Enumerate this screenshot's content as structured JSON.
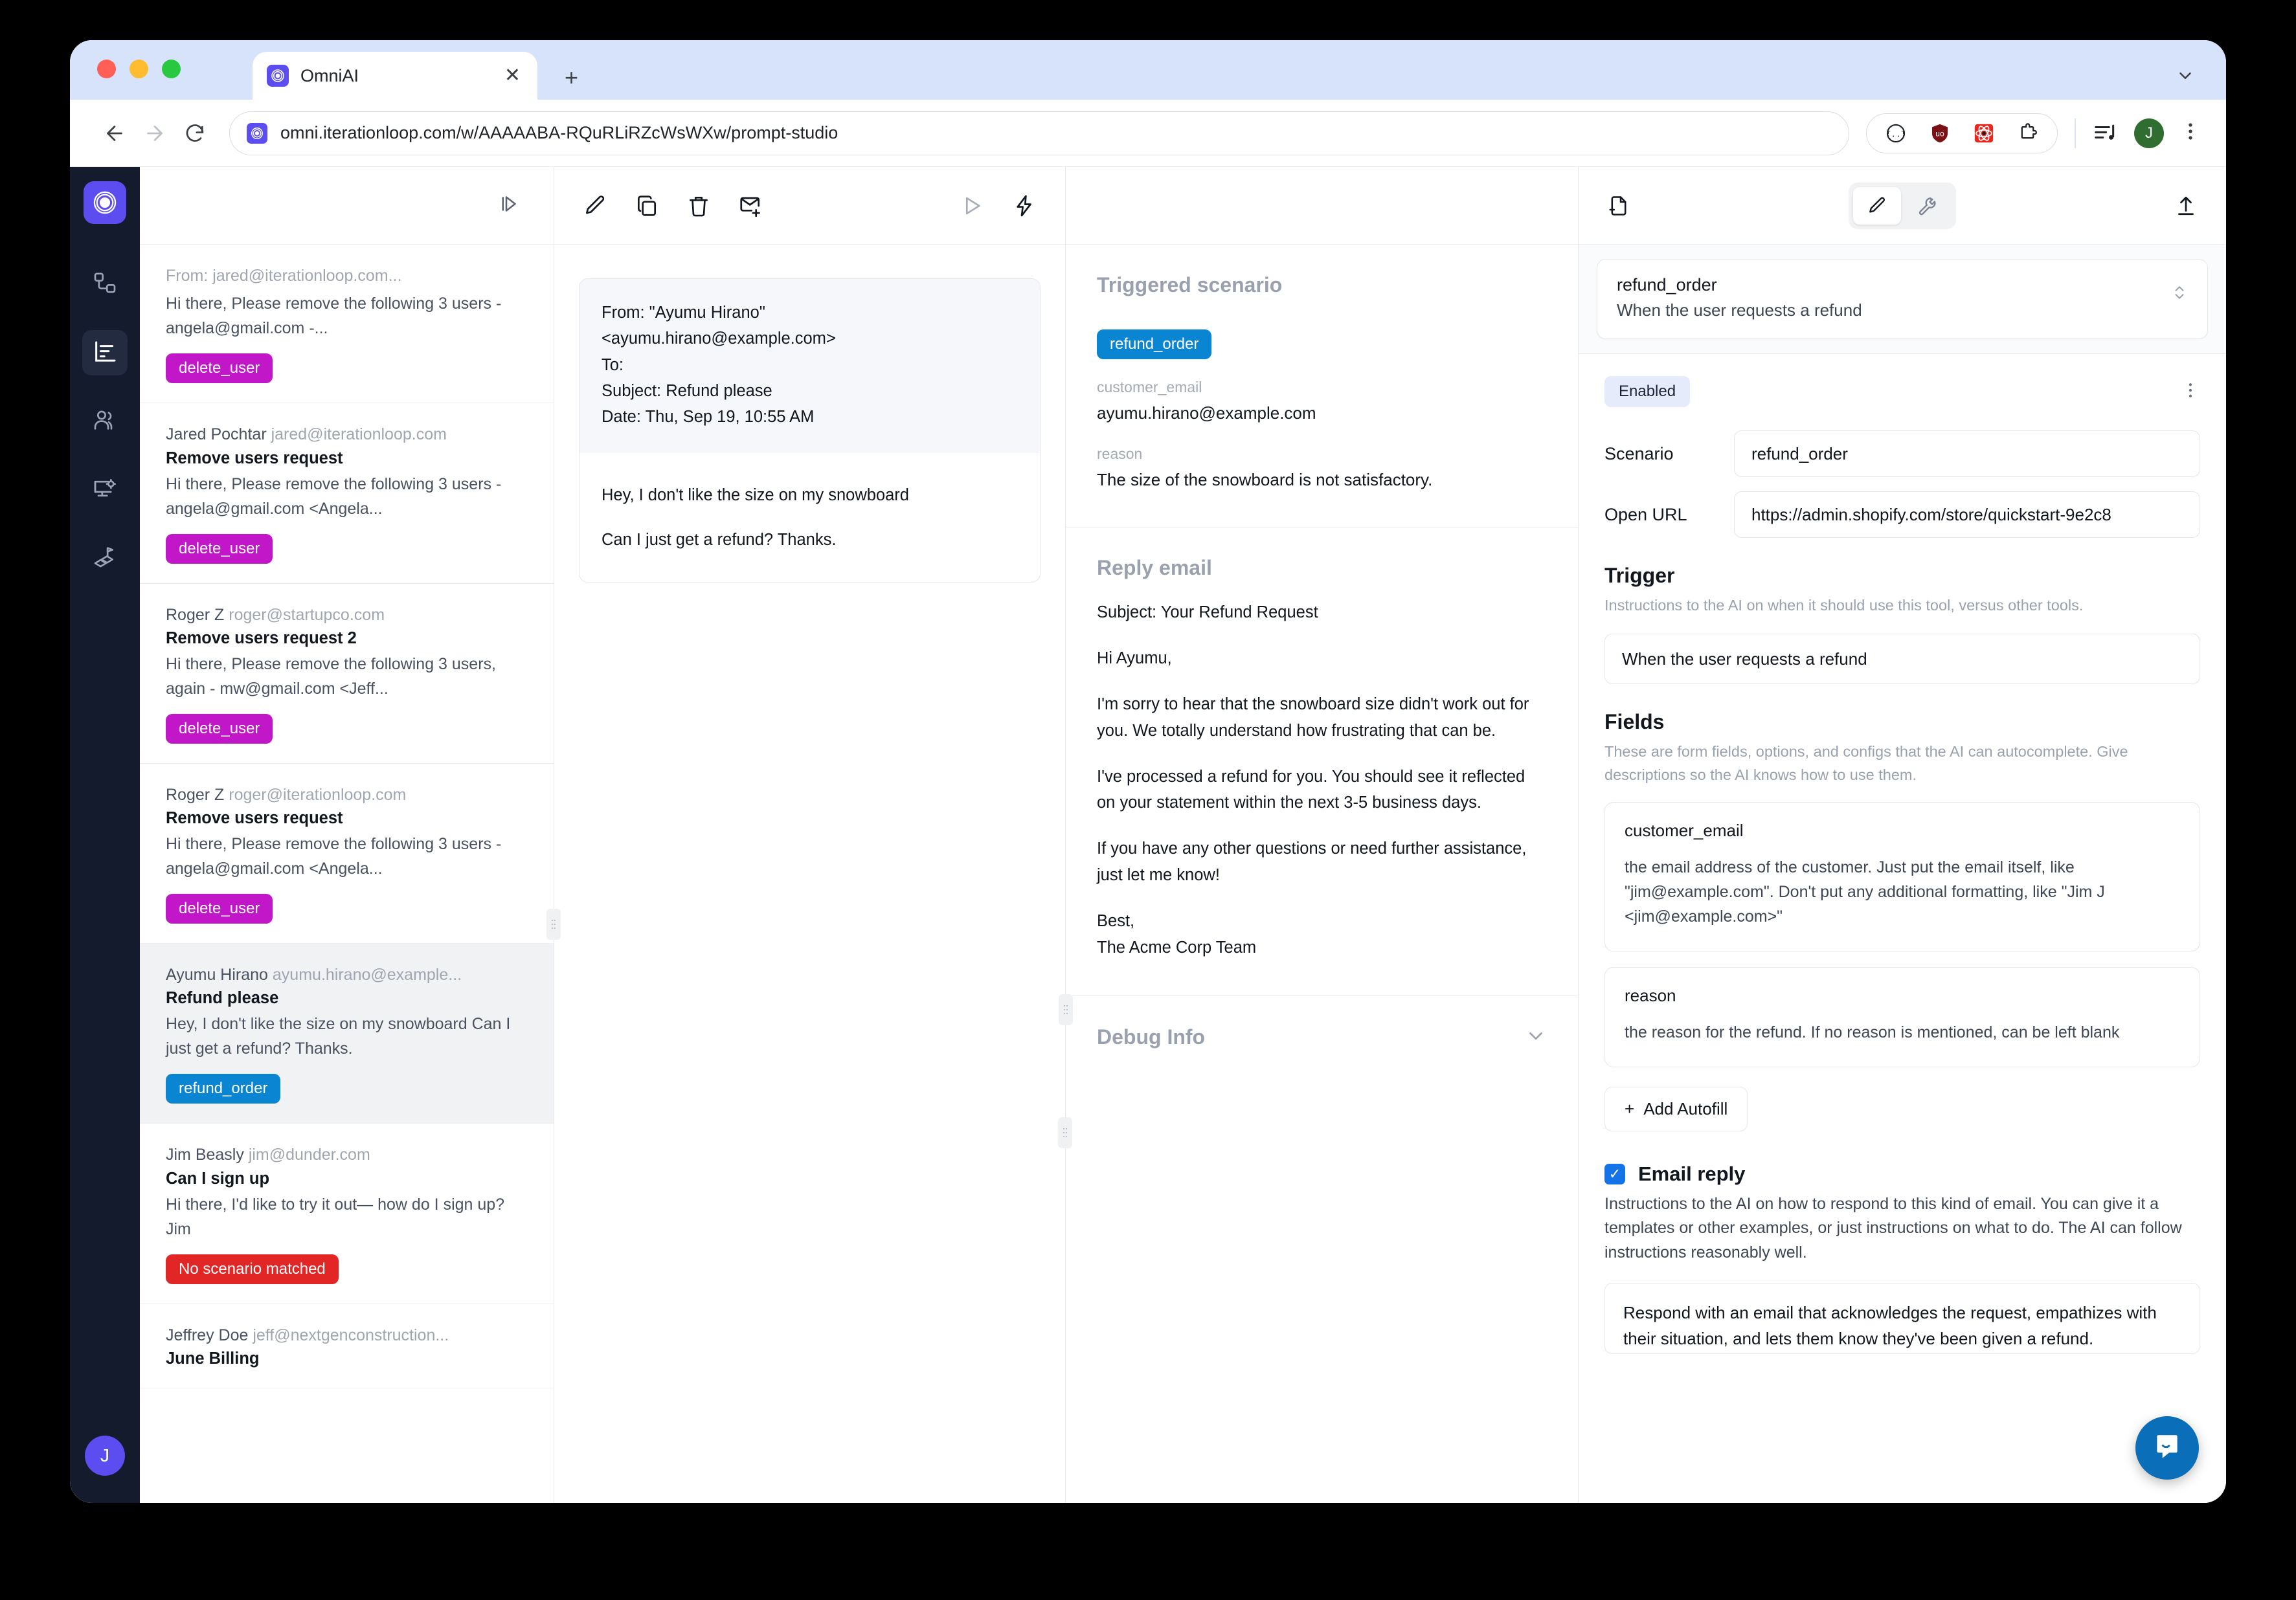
{
  "browser": {
    "tab_title": "OmniAI",
    "tab_close_glyph": "✕",
    "new_tab_glyph": "+",
    "url": "omni.iterationloop.com/w/AAAAABA-RQuRLiRZcWsWXw/prompt-studio",
    "profile_initial": "J"
  },
  "rail": {
    "items": [
      {
        "name": "logo",
        "label": "OmniAI"
      },
      {
        "name": "workflows",
        "label": "Workflows"
      },
      {
        "name": "prompt-studio",
        "label": "Prompt Studio"
      },
      {
        "name": "people",
        "label": "People"
      },
      {
        "name": "devices",
        "label": "Devices"
      },
      {
        "name": "journeys",
        "label": "Journeys"
      }
    ],
    "avatar_initial": "J"
  },
  "mail_list": {
    "items": [
      {
        "meta_name": "",
        "meta_addr": "From: jared@iterationloop.com...",
        "subject": "",
        "snippet": "Hi there, Please remove the following 3 users - angela@gmail.com -...",
        "tag": "delete_user",
        "tag_color": "purple",
        "selected": false
      },
      {
        "meta_name": "Jared Pochtar",
        "meta_addr": "jared@iterationloop.com",
        "subject": "Remove users request",
        "snippet": "Hi there, Please remove the following 3 users - angela@gmail.com <Angela...",
        "tag": "delete_user",
        "tag_color": "purple",
        "selected": false
      },
      {
        "meta_name": "Roger Z",
        "meta_addr": "roger@startupco.com",
        "subject": "Remove users request 2",
        "snippet": "Hi there, Please remove the following 3 users, again - mw@gmail.com <Jeff...",
        "tag": "delete_user",
        "tag_color": "purple",
        "selected": false
      },
      {
        "meta_name": "Roger Z",
        "meta_addr": "roger@iterationloop.com",
        "subject": "Remove users request",
        "snippet": "Hi there, Please remove the following 3 users - angela@gmail.com <Angela...",
        "tag": "delete_user",
        "tag_color": "purple",
        "selected": false
      },
      {
        "meta_name": "Ayumu Hirano",
        "meta_addr": "ayumu.hirano@example...",
        "subject": "Refund please",
        "snippet": "Hey, I don't like the size on my snowboard Can I just get a refund? Thanks.",
        "tag": "refund_order",
        "tag_color": "blue",
        "selected": true
      },
      {
        "meta_name": "Jim Beasly",
        "meta_addr": "jim@dunder.com",
        "subject": "Can I sign up",
        "snippet": "Hi there, I'd like to try it out— how do I sign up? Jim",
        "tag": "No scenario matched",
        "tag_color": "red",
        "selected": false
      },
      {
        "meta_name": "Jeffrey Doe",
        "meta_addr": "jeff@nextgenconstruction...",
        "subject": "June Billing",
        "snippet": "",
        "tag": "",
        "tag_color": "",
        "selected": false
      }
    ]
  },
  "email_preview": {
    "header_lines": [
      "From: \"Ayumu Hirano\"",
      "<ayumu.hirano@example.com>",
      "To:",
      "Subject: Refund please",
      "Date: Thu, Sep 19, 10:55 AM"
    ],
    "body_paragraphs": [
      "Hey, I don't like the size on my snowboard",
      "Can I just get a refund? Thanks."
    ]
  },
  "results": {
    "triggered_scenario": {
      "title": "Triggered scenario",
      "tag": "refund_order",
      "fields": [
        {
          "key": "customer_email",
          "value": "ayumu.hirano@example.com"
        },
        {
          "key": "reason",
          "value": "The size of the snowboard is not satisfactory."
        }
      ]
    },
    "reply_email": {
      "title": "Reply email",
      "paragraphs": [
        "Subject: Your Refund Request",
        "Hi Ayumu,",
        "I'm sorry to hear that the snowboard size didn't work out for you. We totally understand how frustrating that can be.",
        "I've processed a refund for you. You should see it reflected on your statement within the next 3-5 business days.",
        "If you have any other questions or need further assistance, just let me know!",
        "Best,\nThe Acme Corp Team"
      ]
    },
    "debug": {
      "title": "Debug Info"
    }
  },
  "config": {
    "picker": {
      "name": "refund_order",
      "description": "When the user requests a refund"
    },
    "status_badge": "Enabled",
    "scenario_label": "Scenario",
    "scenario_value": "refund_order",
    "open_url_label": "Open URL",
    "open_url_value": "https://admin.shopify.com/store/quickstart-9e2c8",
    "trigger": {
      "title": "Trigger",
      "description": "Instructions to the AI on when it should use this tool, versus other tools.",
      "value": "When the user requests a refund"
    },
    "fields": {
      "title": "Fields",
      "description": "These are form fields, options, and configs that the AI can autocomplete. Give descriptions so the AI knows how to use them.",
      "items": [
        {
          "name": "customer_email",
          "description": "the email address of the customer. Just put the email itself, like \"jim@example.com\". Don't put any additional formatting, like \"Jim J <jim@example.com>\""
        },
        {
          "name": "reason",
          "description": "the reason for the refund. If no reason is mentioned, can be left blank"
        }
      ],
      "add_button": "Add Autofill",
      "add_button_glyph": "+"
    },
    "email_reply": {
      "title": "Email reply",
      "checked": true,
      "description": "Instructions to the AI on how to respond to this kind of email. You can give it a templates or other examples, or just instructions on what to do. The AI can follow instructions reasonably well.",
      "value": "Respond with an email that acknowledges the request, empathizes with their situation, and lets them know they've been given a refund."
    }
  },
  "colors": {
    "brand_purple": "#5b4df0",
    "tag_purple": "#c216c9",
    "tag_blue": "#0a85d1",
    "tag_red": "#e22525",
    "accent_blue": "#1473e6",
    "rail_bg": "#141b2d",
    "intercom_blue": "#0a6fb8"
  }
}
